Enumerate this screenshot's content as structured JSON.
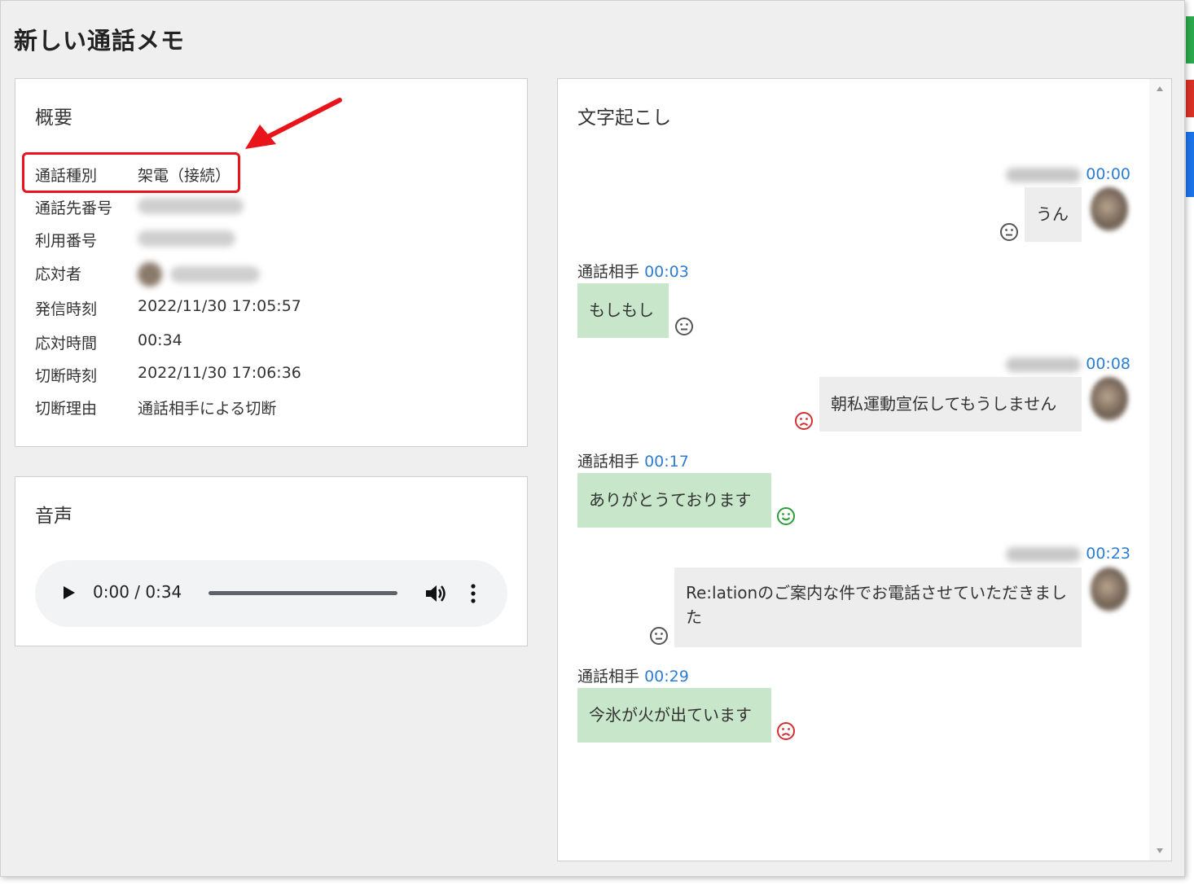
{
  "window": {
    "title": "新しい通話メモ"
  },
  "summary": {
    "heading": "概要",
    "rows": [
      {
        "label": "通話種別",
        "value": "架電（接続）"
      },
      {
        "label": "通話先番号",
        "value": ""
      },
      {
        "label": "利用番号",
        "value": ""
      },
      {
        "label": "応対者",
        "value": ""
      },
      {
        "label": "発信時刻",
        "value": "2022/11/30 17:05:57"
      },
      {
        "label": "応対時間",
        "value": "00:34"
      },
      {
        "label": "切断時刻",
        "value": "2022/11/30 17:06:36"
      },
      {
        "label": "切断理由",
        "value": "通話相手による切断"
      }
    ]
  },
  "audio": {
    "heading": "音声",
    "time_display": "0:00 / 0:34",
    "progress": 0.0
  },
  "transcript": {
    "heading": "文字起こし",
    "messages": [
      {
        "speaker": "",
        "time": "00:00",
        "text": "うん",
        "side": "right",
        "sentiment": "neutral"
      },
      {
        "speaker": "通話相手",
        "time": "00:03",
        "text": "もしもし",
        "side": "left",
        "sentiment": "neutral"
      },
      {
        "speaker": "",
        "time": "00:08",
        "text": "朝私運動宣伝してもうしません",
        "side": "right",
        "sentiment": "negative"
      },
      {
        "speaker": "通話相手",
        "time": "00:17",
        "text": "ありがとうております",
        "side": "left",
        "sentiment": "positive"
      },
      {
        "speaker": "",
        "time": "00:23",
        "text": "Re:lationのご案内な件でお電話させていただきました",
        "side": "right",
        "sentiment": "neutral"
      },
      {
        "speaker": "通話相手",
        "time": "00:29",
        "text": "今氷が火が出ています",
        "side": "left",
        "sentiment": "negative"
      }
    ]
  },
  "colors": {
    "annotation": "#e8141a",
    "timestamp": "#2d7dd2",
    "sentiment_neutral": "#555555",
    "sentiment_negative": "#d32f2f",
    "sentiment_positive": "#2e9e3a",
    "bubble_self": "#ededed",
    "bubble_other": "#c8e6c9"
  }
}
